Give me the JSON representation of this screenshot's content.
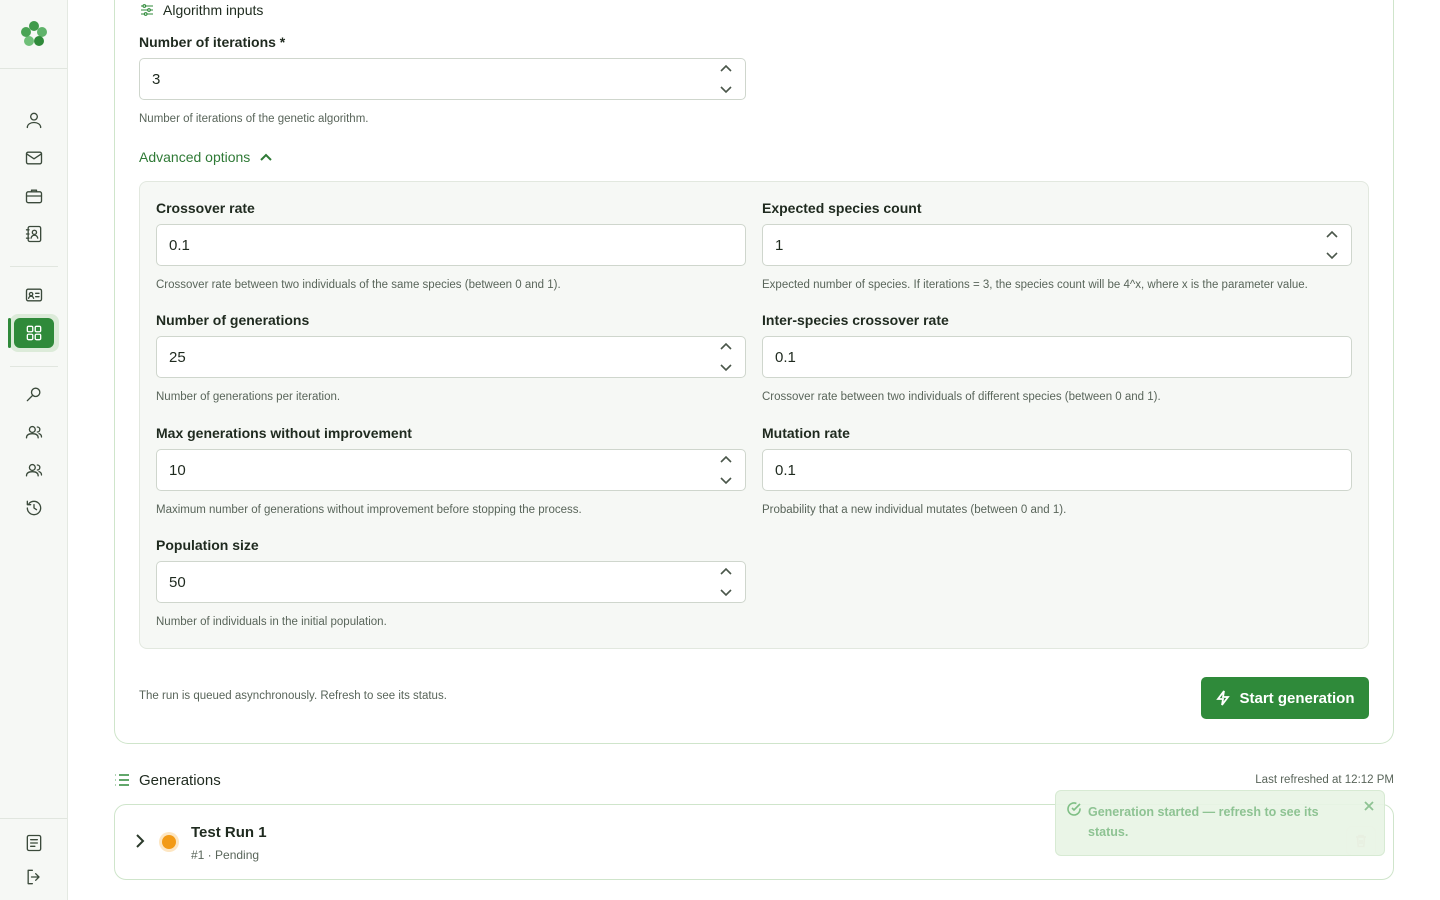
{
  "sidebar": {
    "logo": "app-logo",
    "items": [
      {
        "icon": "user-icon"
      },
      {
        "icon": "mail-icon"
      },
      {
        "icon": "briefcase-icon"
      },
      {
        "icon": "contact-book-icon"
      },
      {
        "icon": "id-card-icon"
      },
      {
        "icon": "grid-icon",
        "active": true
      },
      {
        "icon": "search-icon"
      },
      {
        "icon": "users-icon"
      },
      {
        "icon": "team-icon"
      },
      {
        "icon": "history-icon"
      }
    ],
    "bottom": [
      {
        "icon": "document-icon"
      },
      {
        "icon": "logout-icon"
      }
    ]
  },
  "form": {
    "section_title": "Algorithm inputs",
    "iterations": {
      "label": "Number of iterations *",
      "value": "3",
      "hint": "Number of iterations of the genetic algorithm."
    },
    "advanced_toggle": "Advanced options",
    "advanced": {
      "crossover_rate": {
        "label": "Crossover rate",
        "value": "0.1",
        "hint": "Crossover rate between two individuals of the same species (between 0 and 1)."
      },
      "expected_species": {
        "label": "Expected species count",
        "value": "1",
        "hint": "Expected number of species. If iterations = 3, the species count will be 4^x, where x is the parameter value."
      },
      "generations": {
        "label": "Number of generations",
        "value": "25",
        "hint": "Number of generations per iteration."
      },
      "inter_species_rate": {
        "label": "Inter-species crossover rate",
        "value": "0.1",
        "hint": "Crossover rate between two individuals of different species (between 0 and 1)."
      },
      "max_no_improve": {
        "label": "Max generations without improvement",
        "value": "10",
        "hint": "Maximum number of generations without improvement before stopping the process."
      },
      "mutation_rate": {
        "label": "Mutation rate",
        "value": "0.1",
        "hint": "Probability that a new individual mutates (between 0 and 1)."
      },
      "population": {
        "label": "Population size",
        "value": "50",
        "hint": "Number of individuals in the initial population."
      }
    },
    "footnote": "The run is queued asynchronously. Refresh to see its status.",
    "start_button": "Start generation"
  },
  "generations": {
    "title": "Generations",
    "last_refreshed": "Last refreshed at 12:12 PM",
    "runs": [
      {
        "name": "Test Run 1",
        "meta": "#1 · Pending",
        "status_color": "#f29a16"
      }
    ]
  },
  "toast": {
    "message": "Generation started — refresh to see its status."
  },
  "colors": {
    "accent": "#2f8a3a",
    "pending": "#f29a16"
  }
}
